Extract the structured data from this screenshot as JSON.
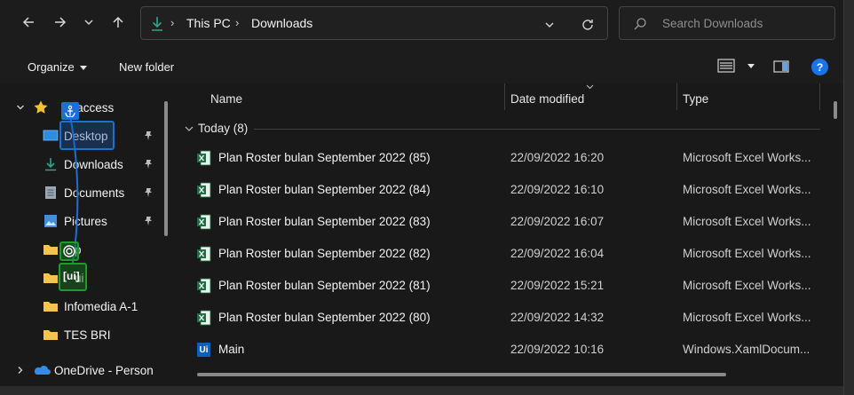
{
  "address_bar": {
    "crumbs": [
      "This PC",
      "Downloads"
    ],
    "search_placeholder": "Search Downloads"
  },
  "command_bar": {
    "organize": "Organize",
    "new_folder": "New folder"
  },
  "nav_pane": {
    "quick_access": "Quick access",
    "quick_access_visible": "ck access",
    "items": [
      {
        "label": "Desktop",
        "icon": "desktop-icon",
        "pinned": true
      },
      {
        "label": "Downloads",
        "icon": "download-icon",
        "pinned": true
      },
      {
        "label": "Documents",
        "icon": "documents-icon",
        "pinned": true
      },
      {
        "label": "Pictures",
        "icon": "pictures-icon",
        "pinned": true
      },
      {
        "label": "p",
        "icon": "folder-icon",
        "pinned": false
      },
      {
        "label": "ui",
        "icon": "folder-icon",
        "pinned": false
      },
      {
        "label": "Infomedia A-1",
        "icon": "folder-icon",
        "pinned": false
      },
      {
        "label": "TES BRI",
        "icon": "folder-icon",
        "pinned": false
      }
    ],
    "onedrive": "OneDrive - Person"
  },
  "columns": {
    "name": "Name",
    "date_modified": "Date modified",
    "type": "Type"
  },
  "group": {
    "label": "Today (8)"
  },
  "files": [
    {
      "name": "Plan Roster bulan September 2022 (85)",
      "date": "22/09/2022 16:20",
      "type": "Microsoft Excel Works...",
      "icon": "excel-icon"
    },
    {
      "name": "Plan Roster bulan September 2022 (84)",
      "date": "22/09/2022 16:10",
      "type": "Microsoft Excel Works...",
      "icon": "excel-icon"
    },
    {
      "name": "Plan Roster bulan September 2022 (83)",
      "date": "22/09/2022 16:07",
      "type": "Microsoft Excel Works...",
      "icon": "excel-icon"
    },
    {
      "name": "Plan Roster bulan September 2022 (82)",
      "date": "22/09/2022 16:04",
      "type": "Microsoft Excel Works...",
      "icon": "excel-icon"
    },
    {
      "name": "Plan Roster bulan September 2022 (81)",
      "date": "22/09/2022 15:21",
      "type": "Microsoft Excel Works...",
      "icon": "excel-icon"
    },
    {
      "name": "Plan Roster bulan September 2022 (80)",
      "date": "22/09/2022 14:32",
      "type": "Microsoft Excel Works...",
      "icon": "excel-icon"
    },
    {
      "name": "Main",
      "date": "22/09/2022 10:16",
      "type": "Windows.XamlDocum...",
      "icon": "xaml-icon"
    }
  ],
  "overlay": {
    "green_label": "[ui]"
  },
  "colors": {
    "background": "#191919",
    "accent_blue": "#1e6fd0",
    "overlay_green": "#1f9a2b",
    "excel_green": "#1d6f42",
    "help_blue": "#1a73e8"
  }
}
